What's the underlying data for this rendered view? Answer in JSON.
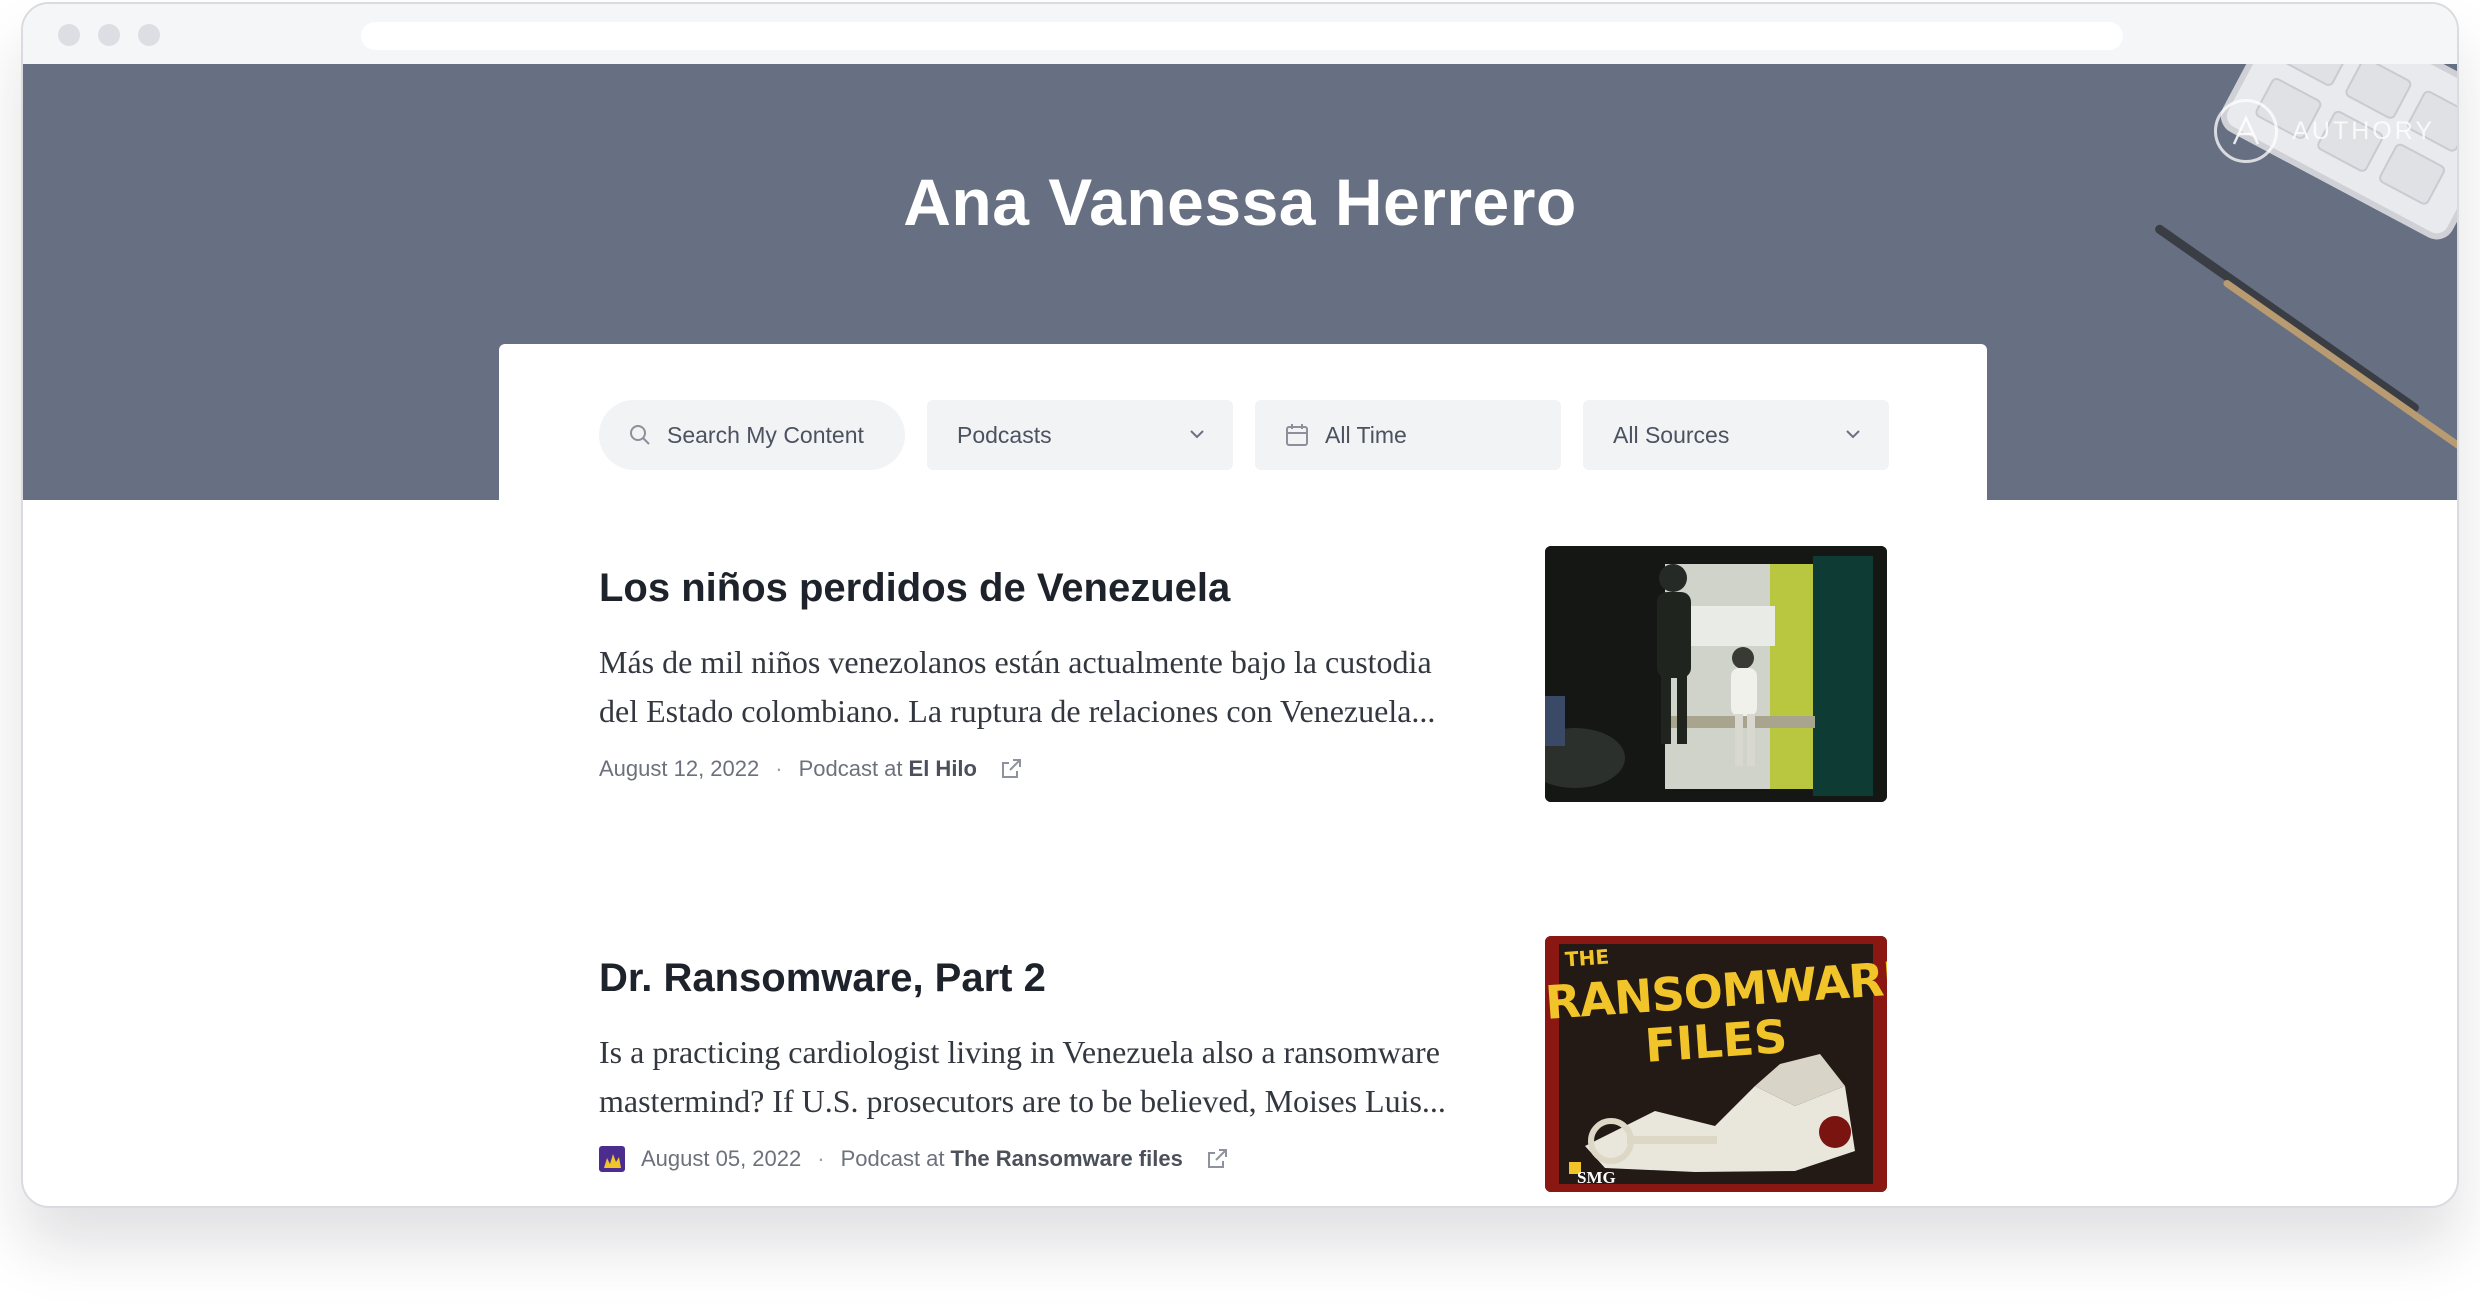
{
  "profile": {
    "name": "Ana Vanessa Herrero"
  },
  "brand": {
    "logo_text": "AUTHORY"
  },
  "filters": {
    "search_placeholder": "Search My Content",
    "type_selected": "Podcasts",
    "time_selected": "All Time",
    "sources_selected": "All Sources"
  },
  "articles": [
    {
      "title": "Los niños perdidos de Venezuela",
      "excerpt_line1": "Más de mil niños venezolanos están actualmente bajo la custodia",
      "excerpt_line2": "del Estado colombiano. La ruptura de relaciones con Venezuela...",
      "date": "August 12, 2022",
      "type_prefix": "Podcast at",
      "source": "El Hilo"
    },
    {
      "title": "Dr. Ransomware, Part 2",
      "excerpt_line1": "Is a practicing cardiologist living in Venezuela also a ransomware",
      "excerpt_line2": "mastermind? If U.S. prosecutors are to be believed, Moises Luis...",
      "date": "August 05, 2022",
      "type_prefix": "Podcast at",
      "source": "The Ransomware files",
      "thumbnail_text": {
        "line1": "THE",
        "line2": "RANSOMWARE",
        "line3": "FILES",
        "badge": "SMG"
      }
    }
  ],
  "colors": {
    "hero_bg": "#677082",
    "panel_bg": "#ffffff",
    "filter_bg": "#f2f3f5",
    "favicon": "#4a2d8f",
    "cover_yellow": "#f1c52a",
    "cover_red": "#7a1410"
  },
  "icons": [
    "search-icon",
    "chevron-down-icon",
    "calendar-icon",
    "external-link-icon",
    "authory-logo-icon"
  ]
}
